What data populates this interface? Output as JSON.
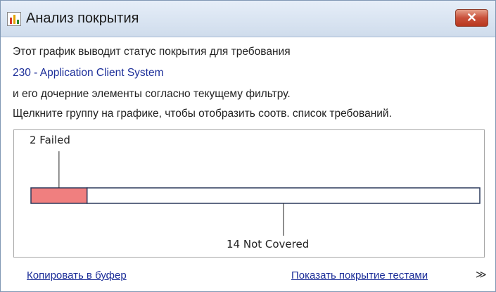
{
  "window": {
    "title": "Анализ покрытия",
    "close_label": "✕"
  },
  "description": {
    "line1": "Этот график выводит статус покрытия для требования",
    "requirement_link": "230 - Application Client System",
    "line3": "и его дочерние элементы согласно текущему фильтру.",
    "line4": "Щелкните группу на графике, чтобы отобразить соотв. список требований."
  },
  "chart_data": {
    "type": "bar",
    "orientation": "horizontal-stacked",
    "categories": [
      "Failed",
      "Not Covered"
    ],
    "values": [
      2,
      14
    ],
    "labels": [
      "2 Failed",
      "14 Not Covered"
    ],
    "colors": [
      "#f07f7f",
      "#ffffff"
    ]
  },
  "footer": {
    "copy_link": "Копировать в буфер",
    "show_tests_link": "Показать покрытие тестами",
    "chevron": "≫"
  }
}
